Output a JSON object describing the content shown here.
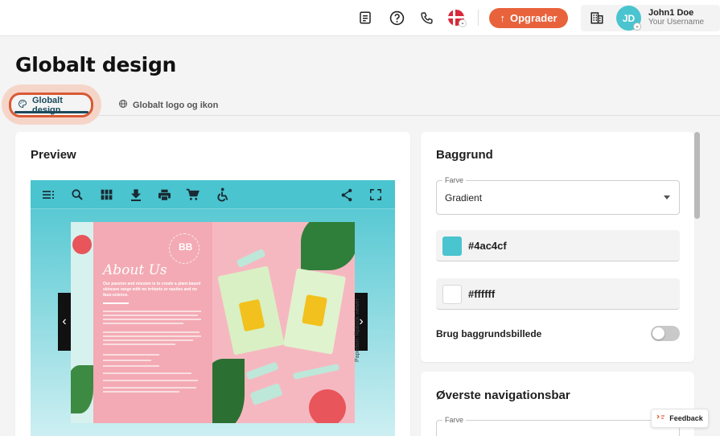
{
  "topbar": {
    "icons": [
      "document-icon",
      "help-icon",
      "phone-icon",
      "flag-denmark-icon"
    ],
    "upgrade_label": "Opgrader",
    "company_icon": "building-icon",
    "user": {
      "initials": "JD",
      "name": "John1 Doe",
      "subtitle": "Your Username"
    },
    "colors": {
      "accent": "#e8623c",
      "avatar": "#4ac4cf"
    }
  },
  "page": {
    "title": "Globalt design",
    "tabs": [
      {
        "label": "Globalt design",
        "icon": "palette-icon",
        "active": true
      },
      {
        "label": "Globalt logo og ikon",
        "icon": "globe-icon",
        "active": false
      }
    ]
  },
  "preview": {
    "title": "Preview",
    "toolbar_icons": [
      "menu-icon",
      "search-icon",
      "grid-icon",
      "download-icon",
      "print-icon",
      "cart-icon",
      "accessibility-icon",
      "share-icon",
      "fullscreen-icon"
    ],
    "book": {
      "heading": "About Us",
      "lead": "Our passion and mission is to create a plant-based skincare range with no irritants or nasties and no faux-science."
    },
    "watermark": "Paperturn flipbook viewer"
  },
  "background": {
    "title": "Baggrund",
    "color_field_label": "Farve",
    "color_mode": "Gradient",
    "color_1": "#4ac4cf",
    "color_2": "#ffffff",
    "image_toggle_label": "Brug baggrundsbillede",
    "image_toggle_on": false
  },
  "top_nav": {
    "title": "Øverste navigationsbar",
    "color_field_label": "Farve"
  },
  "feedback": {
    "label": "Feedback"
  }
}
